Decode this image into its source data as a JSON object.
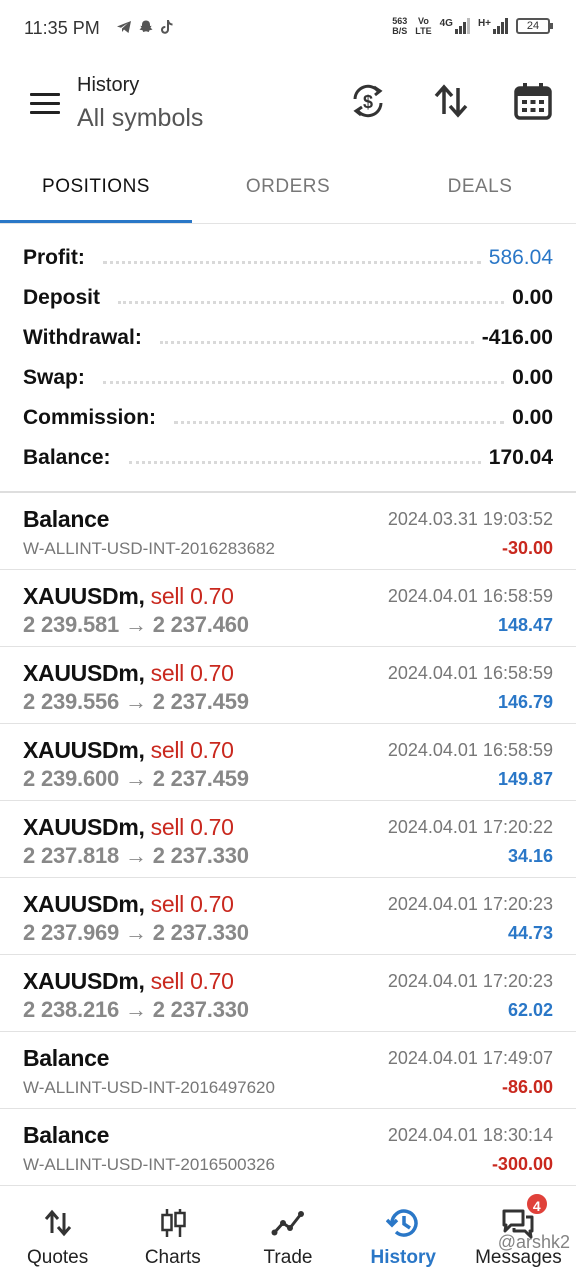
{
  "status_bar": {
    "time": "11:35 PM",
    "netspeed_value": "563",
    "netspeed_unit": "B/S",
    "volte_top": "Vo",
    "volte_bottom": "LTE",
    "signal1_label": "4G",
    "signal2_label": "H+",
    "battery": "24",
    "app_icons": [
      "telegram-icon",
      "snapchat-icon",
      "tiktok-icon"
    ]
  },
  "header": {
    "title": "History",
    "subtitle": "All symbols",
    "icons": [
      "currency-exchange-icon",
      "sort-icon",
      "calendar-icon"
    ]
  },
  "tabs": [
    {
      "label": "POSITIONS",
      "active": true
    },
    {
      "label": "ORDERS",
      "active": false
    },
    {
      "label": "DEALS",
      "active": false
    }
  ],
  "summary": {
    "profit": {
      "label": "Profit:",
      "value": "586.04"
    },
    "deposit": {
      "label": "Deposit",
      "value": "0.00"
    },
    "withdrawal": {
      "label": "Withdrawal:",
      "value": "-416.00"
    },
    "swap": {
      "label": "Swap:",
      "value": "0.00"
    },
    "commission": {
      "label": "Commission:",
      "value": "0.00"
    },
    "balance": {
      "label": "Balance:",
      "value": "170.04"
    }
  },
  "deals": [
    {
      "symbol": "Balance",
      "comment": "W-ALLINT-USD-INT-2016283682",
      "time": "2024.03.31 19:03:52",
      "profit": "-30.00"
    },
    {
      "symbol": "XAUUSDm,",
      "side": "sell",
      "lot": "0.70",
      "open": "2 239.581",
      "arrow": "→",
      "close": "2 237.460",
      "time": "2024.04.01 16:58:59",
      "profit": "148.47"
    },
    {
      "symbol": "XAUUSDm,",
      "side": "sell",
      "lot": "0.70",
      "open": "2 239.556",
      "arrow": "→",
      "close": "2 237.459",
      "time": "2024.04.01 16:58:59",
      "profit": "146.79"
    },
    {
      "symbol": "XAUUSDm,",
      "side": "sell",
      "lot": "0.70",
      "open": "2 239.600",
      "arrow": "→",
      "close": "2 237.459",
      "time": "2024.04.01 16:58:59",
      "profit": "149.87"
    },
    {
      "symbol": "XAUUSDm,",
      "side": "sell",
      "lot": "0.70",
      "open": "2 237.818",
      "arrow": "→",
      "close": "2 237.330",
      "time": "2024.04.01 17:20:22",
      "profit": "34.16"
    },
    {
      "symbol": "XAUUSDm,",
      "side": "sell",
      "lot": "0.70",
      "open": "2 237.969",
      "arrow": "→",
      "close": "2 237.330",
      "time": "2024.04.01 17:20:23",
      "profit": "44.73"
    },
    {
      "symbol": "XAUUSDm,",
      "side": "sell",
      "lot": "0.70",
      "open": "2 238.216",
      "arrow": "→",
      "close": "2 237.330",
      "time": "2024.04.01 17:20:23",
      "profit": "62.02"
    },
    {
      "symbol": "Balance",
      "comment": "W-ALLINT-USD-INT-2016497620",
      "time": "2024.04.01 17:49:07",
      "profit": "-86.00"
    },
    {
      "symbol": "Balance",
      "comment": "W-ALLINT-USD-INT-2016500326",
      "time": "2024.04.01 18:30:14",
      "profit": "-300.00"
    }
  ],
  "bottom_nav": [
    {
      "label": "Quotes",
      "icon": "quotes-icon",
      "active": false
    },
    {
      "label": "Charts",
      "icon": "candlestick-icon",
      "active": false
    },
    {
      "label": "Trade",
      "icon": "trade-line-icon",
      "active": false
    },
    {
      "label": "History",
      "icon": "history-icon",
      "active": true
    },
    {
      "label": "Messages",
      "icon": "chat-icon",
      "active": false,
      "badge": "4"
    }
  ],
  "watermark": "@arshk2",
  "colors": {
    "accent_blue": "#2a77c7",
    "loss_red": "#c9281e",
    "badge_red": "#e0413a"
  }
}
